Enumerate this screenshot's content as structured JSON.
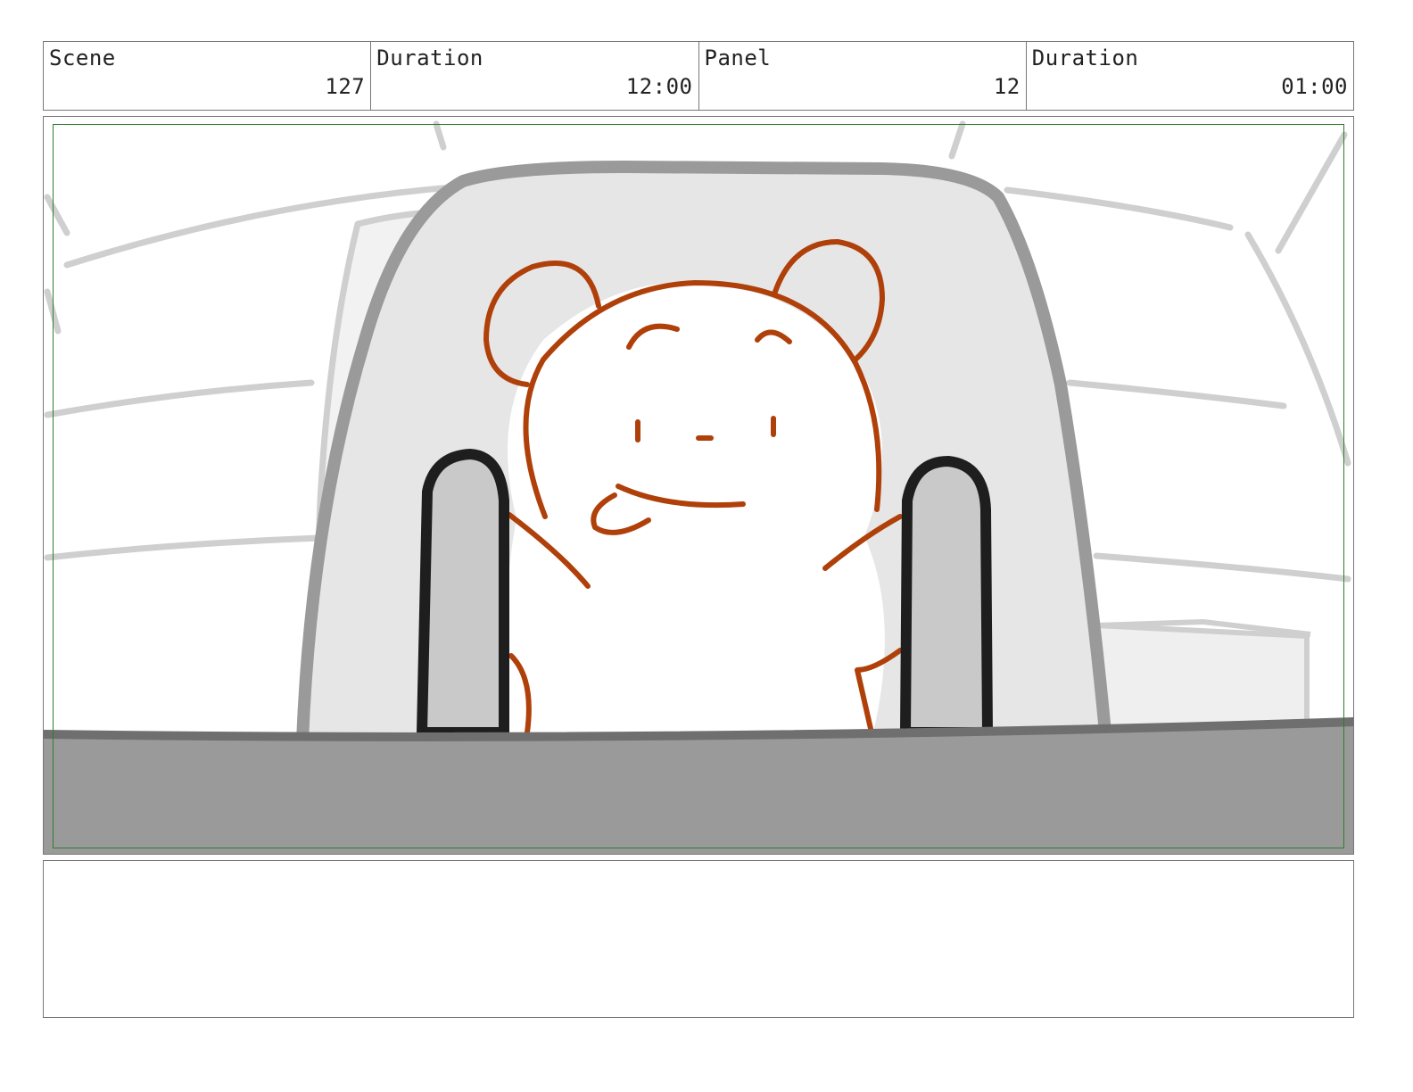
{
  "header": {
    "scene_label": "Scene",
    "scene_value": "127",
    "scene_duration_label": "Duration",
    "scene_duration_value": "12:00",
    "panel_label": "Panel",
    "panel_value": "12",
    "panel_duration_label": "Duration",
    "panel_duration_value": "01:00"
  },
  "notes": {
    "text": ""
  },
  "colors": {
    "bear_line": "#b0400a",
    "seat_fill": "#e6e6e6",
    "seat_outline": "#9a9a9a",
    "dashboard": "#9a9a9a",
    "safe_frame": "#2e7d2e"
  }
}
